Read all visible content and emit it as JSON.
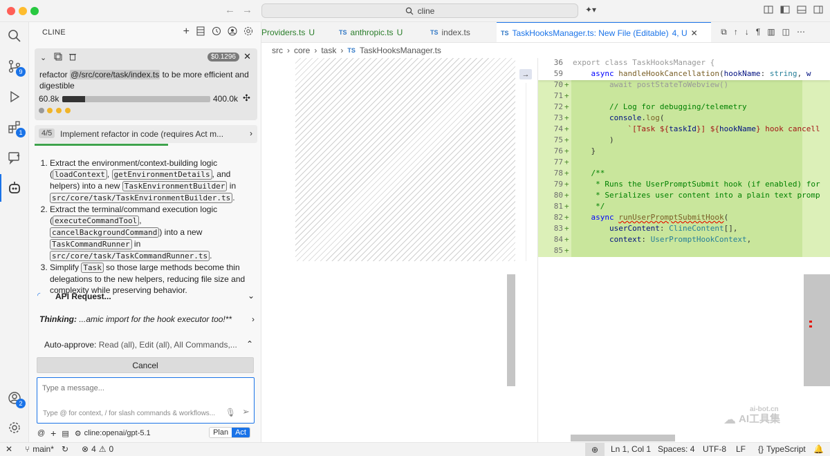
{
  "window": {
    "search_text": "cline"
  },
  "activity_bar": {
    "source_control_badge": "9",
    "extensions_badge": "1",
    "accounts_badge": "2"
  },
  "sidebar": {
    "title": "CLINE",
    "task": {
      "cost": "$0.1296",
      "text_prefix": "refactor ",
      "mention": "@/src/core/task/index.ts",
      "text_suffix": " to be more efficient and digestible",
      "tokens_used": "60.8k",
      "tokens_max": "400.0k",
      "context_usage_fraction": 0.152
    },
    "step": {
      "index": "4/5",
      "label": "Implement refactor in code (requires Act m...",
      "progress_fraction": 0.6
    },
    "plan": [
      {
        "t1": "Extract the environment/context-building logic (",
        "c1": "loadContext",
        "t2": ", ",
        "c2": "getEnvironmentDetails",
        "t3": ", and helpers) into a new ",
        "c3": "TaskEnvironmentBuilder",
        "t4": " in ",
        "c4": "src/core/task/TaskEnvironmentBuilder.ts",
        "t5": "."
      },
      {
        "t1": "Extract the terminal/command execution logic (",
        "c1": "executeCommandTool",
        "t2": ", ",
        "c2": "cancelBackgroundCommand",
        "t3": ") into a new ",
        "c3": "TaskCommandRunner",
        "t4": " in ",
        "c4": "src/core/task/TaskCommandRunner.ts",
        "t5": "."
      },
      {
        "t1": "Simplify ",
        "c1": "Task",
        "t2": " so those large methods become thin delegations to the new helpers, reducing file size and complexity while preserving behavior."
      }
    ],
    "api_request": "API Request...",
    "thinking_label": "Thinking:",
    "thinking_text": " ...amic import for the hook executor too!**",
    "auto_approve_label": "Auto-approve:",
    "auto_approve_value": " Read (all), Edit (all), All Commands,...",
    "cancel_label": "Cancel",
    "input_placeholder": "Type a message...",
    "input_hint": "Type @ for context, / for slash commands & workflows...",
    "model": "cline:openai/gpt-5.1",
    "mode_plan": "Plan",
    "mode_act": "Act"
  },
  "tabs": [
    {
      "name": "Providers.ts",
      "status": "U",
      "icon": "",
      "active": false
    },
    {
      "name": "anthropic.ts",
      "status": "U",
      "icon": "TS",
      "active": false
    },
    {
      "name": "index.ts",
      "status": "",
      "icon": "TS",
      "active": false
    },
    {
      "name": "TaskHooksManager.ts: New File (Editable)",
      "status": "4, U",
      "icon": "TS",
      "active": true
    }
  ],
  "breadcrumb": [
    "src",
    "core",
    "task",
    "TaskHooksManager.ts"
  ],
  "breadcrumb_file_icon": "TS",
  "code": {
    "sticky": [
      {
        "ln": "36",
        "html": "<span class='dim'>export class TaskHooksManager {</span>"
      },
      {
        "ln": "59",
        "html": "    <span class='kw'>async</span> <span class='fn'>handleHookCancellation</span>(<span class='var'>hookName</span>: <span class='ty'>string</span>, <span class='var'>w</span>"
      }
    ],
    "lines": [
      {
        "ln": "70",
        "html": "        <span class='dim'>await postStateToWebview()</span>"
      },
      {
        "ln": "71",
        "html": ""
      },
      {
        "ln": "72",
        "html": "        <span class='cm'>// Log for debugging/telemetry</span>"
      },
      {
        "ln": "73",
        "html": "        <span class='var'>console</span>.<span class='fn'>log</span>("
      },
      {
        "ln": "74",
        "html": "            <span class='str'>`[Task ${</span><span class='var'>taskId</span><span class='str'>}] ${</span><span class='var'>hookName</span><span class='str'>} hook cancell</span>"
      },
      {
        "ln": "75",
        "html": "        )"
      },
      {
        "ln": "76",
        "html": "    }"
      },
      {
        "ln": "77",
        "html": ""
      },
      {
        "ln": "78",
        "html": "    <span class='cm'>/**</span>"
      },
      {
        "ln": "79",
        "html": "     <span class='cm'>* Runs the UserPromptSubmit hook (if enabled) for</span>"
      },
      {
        "ln": "80",
        "html": "     <span class='cm'>* Serializes user content into a plain text promp</span>"
      },
      {
        "ln": "81",
        "html": "     <span class='cm'>*/</span>"
      },
      {
        "ln": "82",
        "html": "    <span class='kw'>async</span> <span class='fn' style='text-decoration:underline wavy #e51400'>runUserPromptSubmitHook</span>("
      },
      {
        "ln": "83",
        "html": "        <span class='var'>userContent</span>: <span class='ty'>ClineContent</span>[],"
      },
      {
        "ln": "84",
        "html": "        <span class='var'>context</span>: <span class='ty'>UserPromptHookContext</span>,"
      },
      {
        "ln": "85",
        "html": ""
      }
    ]
  },
  "status": {
    "branch": "main*",
    "errors": "4",
    "warnings": "0",
    "position": "Ln 1, Col 1",
    "spaces": "Spaces: 4",
    "encoding": "UTF-8",
    "eol": "LF",
    "language": "TypeScript"
  },
  "watermark": {
    "line1": "ai-bot.cn",
    "line2": "AI工具集"
  }
}
